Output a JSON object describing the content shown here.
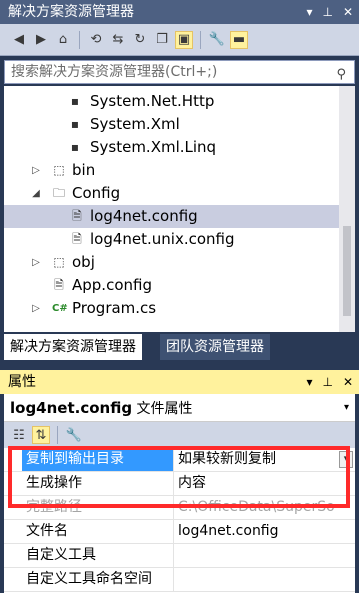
{
  "solution_explorer": {
    "title": "解决方案资源管理器",
    "title_icons": [
      "dropdown-icon",
      "pin-icon",
      "close-icon"
    ],
    "search_placeholder": "搜索解决方案资源管理器(Ctrl+;)",
    "tree": [
      {
        "label": "System.Net.Http",
        "kind": "reference",
        "expander": ""
      },
      {
        "label": "System.Xml",
        "kind": "reference",
        "expander": ""
      },
      {
        "label": "System.Xml.Linq",
        "kind": "reference",
        "expander": ""
      },
      {
        "label": "bin",
        "kind": "folder-dotted",
        "expander": "▷"
      },
      {
        "label": "Config",
        "kind": "folder-open",
        "expander": "◢"
      },
      {
        "label": "log4net.config",
        "kind": "config-file",
        "expander": "",
        "selected": true
      },
      {
        "label": "log4net.unix.config",
        "kind": "config-file",
        "expander": ""
      },
      {
        "label": "obj",
        "kind": "folder-dotted",
        "expander": "▷"
      },
      {
        "label": "App.config",
        "kind": "config-file",
        "expander": ""
      },
      {
        "label": "Program.cs",
        "kind": "csharp-file",
        "expander": "▷"
      }
    ],
    "tabs": [
      {
        "label": "解决方案资源管理器",
        "active": true
      },
      {
        "label": "团队资源管理器",
        "active": false
      }
    ]
  },
  "properties": {
    "title": "属性",
    "object_name": "log4net.config",
    "object_type": "文件属性",
    "rows": [
      {
        "name": "复制到输出目录",
        "value": "如果较新则复制",
        "selected": true,
        "dropdown": true
      },
      {
        "name": "生成操作",
        "value": "内容"
      },
      {
        "name": "完整路径",
        "value": "C:\\OfficeData\\SuperSo",
        "dim": true
      },
      {
        "name": "文件名",
        "value": "log4net.config"
      },
      {
        "name": "自定义工具",
        "value": ""
      },
      {
        "name": "自定义工具命名空间",
        "value": ""
      }
    ]
  },
  "colors": {
    "highlight_border": "#ff2a2a",
    "selected_row": "#3399ff",
    "active_title": "#fff29d"
  }
}
